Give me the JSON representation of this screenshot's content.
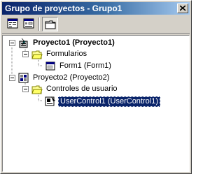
{
  "window": {
    "title": "Grupo de proyectos - Grupo1"
  },
  "toolbar": {
    "buttons": [
      {
        "name": "view-code"
      },
      {
        "name": "view-object"
      },
      {
        "name": "toggle-folders",
        "pressed": true
      }
    ]
  },
  "tree": {
    "nodes": [
      {
        "label": "Proyecto1 (Proyecto1)",
        "icon": "project-exe-icon",
        "bold": true,
        "expanded": true
      },
      {
        "label": "Formularios",
        "icon": "folder-open-icon",
        "expanded": true
      },
      {
        "label": "Form1 (Form1)",
        "icon": "form-icon"
      },
      {
        "label": "Proyecto2 (Proyecto2)",
        "icon": "project-ocx-icon",
        "expanded": true
      },
      {
        "label": "Controles de usuario",
        "icon": "folder-open-icon",
        "expanded": true
      },
      {
        "label": "UserControl1 (UserControl1)",
        "icon": "usercontrol-icon",
        "selected": true
      }
    ]
  },
  "colors": {
    "title_start": "#0a246a",
    "title_end": "#a6caf0",
    "selection": "#0a246a",
    "face": "#d4d0c8"
  }
}
